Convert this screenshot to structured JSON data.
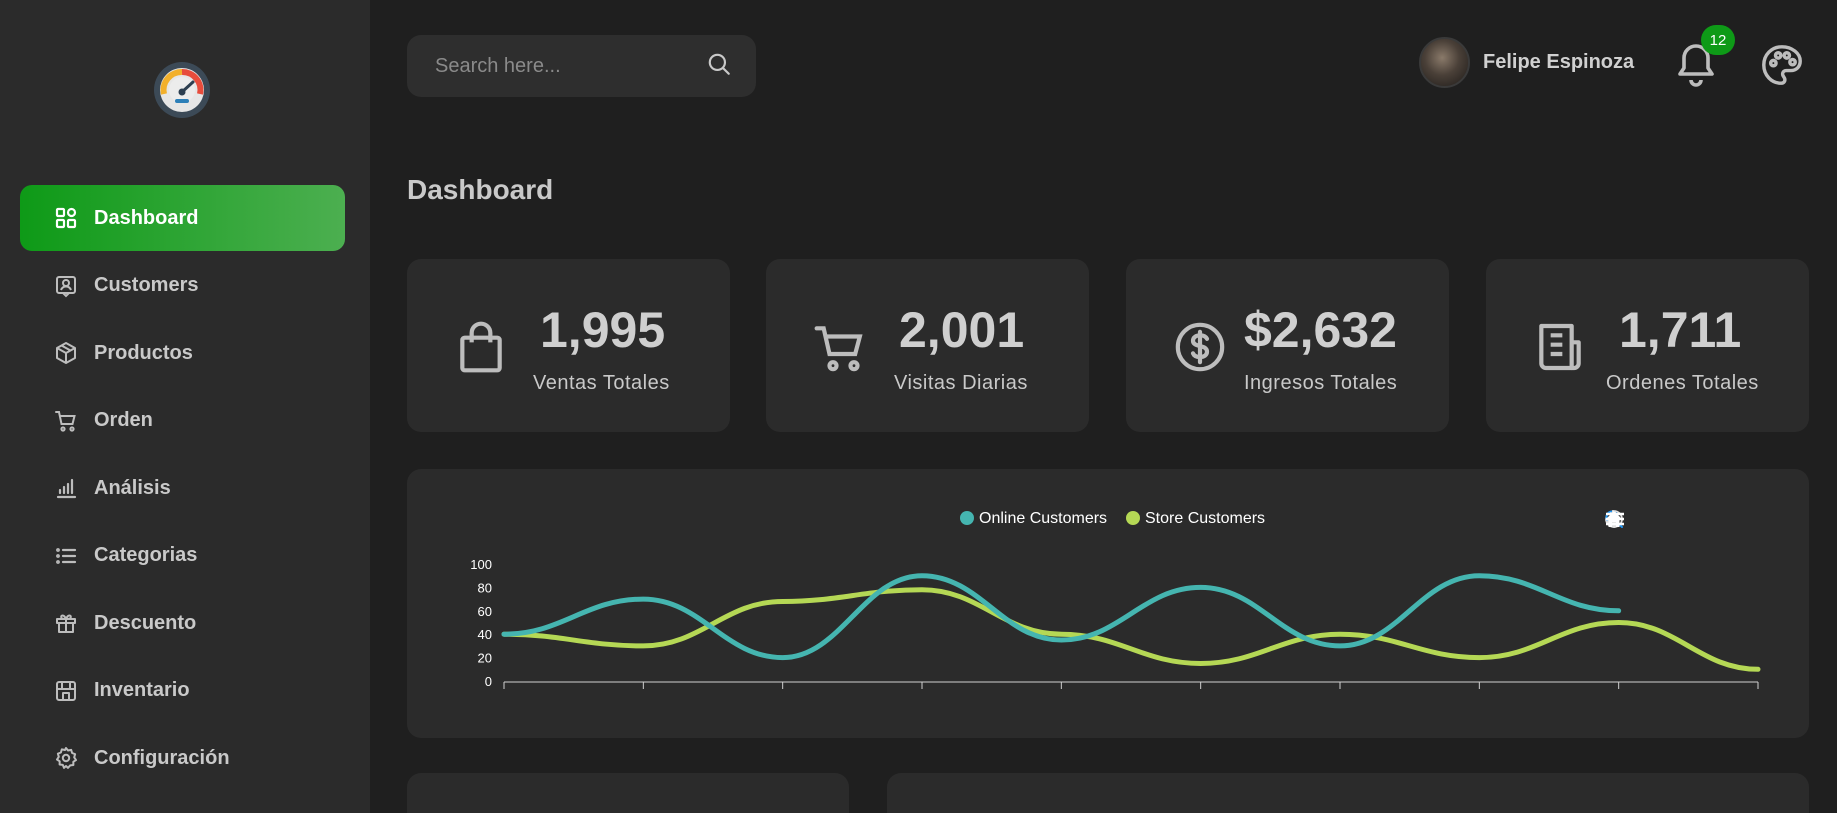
{
  "sidebar": {
    "items": [
      {
        "label": "Dashboard",
        "icon": "dashboard-icon"
      },
      {
        "label": "Customers",
        "icon": "customer-icon"
      },
      {
        "label": "Productos",
        "icon": "box-icon"
      },
      {
        "label": "Orden",
        "icon": "cart-icon"
      },
      {
        "label": "Análisis",
        "icon": "bar-chart-icon"
      },
      {
        "label": "Categorias",
        "icon": "list-icon"
      },
      {
        "label": "Descuento",
        "icon": "gift-icon"
      },
      {
        "label": "Inventario",
        "icon": "store-icon"
      },
      {
        "label": "Configuración",
        "icon": "gear-icon"
      }
    ],
    "active_item": "Dashboard"
  },
  "header": {
    "search_placeholder": "Search here...",
    "user_name": "Felipe Espinoza",
    "notification_count": "12"
  },
  "page": {
    "title": "Dashboard"
  },
  "stats": [
    {
      "value": "1,995",
      "label": "Ventas Totales",
      "icon": "shopping-bag-icon"
    },
    {
      "value": "2,001",
      "label": "Visitas Diarias",
      "icon": "cart-icon"
    },
    {
      "value": "$2,632",
      "label": "Ingresos Totales",
      "icon": "dollar-icon"
    },
    {
      "value": "1,711",
      "label": "Ordenes Totales",
      "icon": "receipt-icon"
    }
  ],
  "colors": {
    "accent": "#0e9a17",
    "online": "#45b5b0",
    "store": "#b5d855"
  },
  "chart_data": {
    "type": "line",
    "x": [
      0,
      1,
      2,
      3,
      4,
      5,
      6,
      7,
      8,
      9
    ],
    "series": [
      {
        "name": "Online Customers",
        "values": [
          40,
          70,
          20,
          90,
          35,
          80,
          30,
          90,
          60,
          null
        ]
      },
      {
        "name": "Store Customers",
        "values": [
          40,
          30,
          68,
          78,
          40,
          15,
          40,
          20,
          50,
          10
        ]
      }
    ],
    "yticks": [
      "0",
      "20",
      "40",
      "60",
      "80",
      "100"
    ],
    "ylim": [
      0,
      100
    ],
    "legend": "top-center",
    "grid": false
  }
}
